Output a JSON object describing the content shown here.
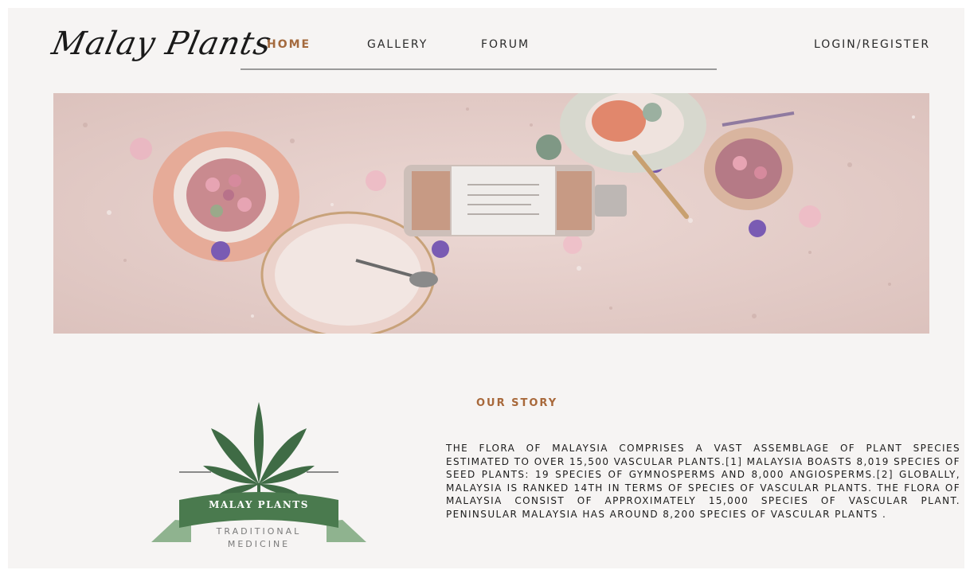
{
  "brand": {
    "name": "Malay Plants"
  },
  "nav": {
    "items": [
      {
        "label": "HOME",
        "active": true
      },
      {
        "label": "GALLERY",
        "active": false
      },
      {
        "label": "FORUM",
        "active": false
      }
    ],
    "login_label": "LOGIN/REGISTER"
  },
  "story": {
    "title": "OUR STORY",
    "body": "THE FLORA OF MALAYSIA COMPRISES A VAST ASSEMBLAGE OF PLANT SPECIES ESTIMATED TO OVER 15,500 VASCULAR PLANTS.[1] MALAYSIA BOASTS 8,019 SPECIES OF SEED PLANTS: 19 SPECIES OF GYMNOSPERMS AND 8,000 ANGIOSPERMS.[2] GLOBALLY, MALAYSIA IS RANKED 14TH IN TERMS OF SPECIES OF VASCULAR PLANTS. THE FLORA OF MALAYSIA CONSIST OF APPROXIMATELY 15,000 SPECIES OF VASCULAR PLANT. PENINSULAR MALAYSIA HAS AROUND 8,200 SPECIES OF VASCULAR PLANTS ."
  },
  "emblem": {
    "banner_text": "MALAY PLANTS",
    "sub_line1": "TRADITIONAL",
    "sub_line2": "MEDICINE"
  },
  "colors": {
    "accent": "#a8683a",
    "emblem_green": "#4a7a4e",
    "hero_bg": "#e5cfcb"
  }
}
